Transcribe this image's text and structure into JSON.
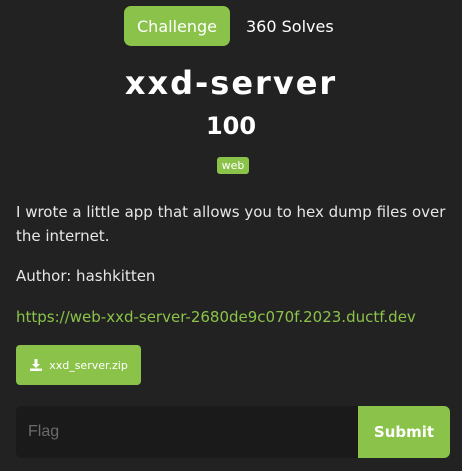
{
  "tabs": {
    "challenge_label": "Challenge",
    "solves_label": "360 Solves"
  },
  "challenge": {
    "name": "xxd-server",
    "points": "100",
    "tag": "web",
    "description": "I wrote a little app that allows you to hex dump files over the internet.",
    "author": "Author: hashkitten",
    "url": "https://web-xxd-server-2680de9c070f.2023.ductf.dev",
    "file_name": "xxd_server.zip"
  },
  "flag_form": {
    "placeholder": "Flag",
    "submit_label": "Submit"
  },
  "colors": {
    "background": "#222222",
    "accent": "#8bc34a",
    "input_background": "#1a1a1a"
  },
  "icons": {
    "file_button": "download-icon"
  }
}
